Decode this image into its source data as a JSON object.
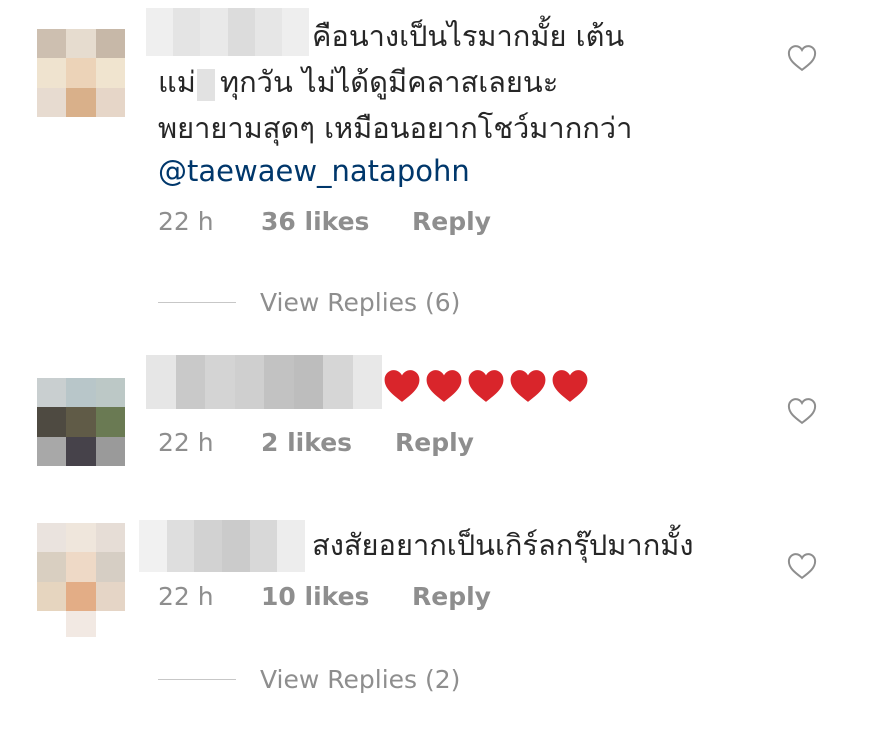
{
  "comments": [
    {
      "text_lines": [
        "คือนางเป็นไรมากมั้ย เต้น",
        "แม่",
        "ทุกวัน ไม่ได้ดูมีคลาสเลยนะ",
        "พยายามสุดๆ เหมือนอยากโชว์มากกว่า"
      ],
      "mention": "@taewaew_natapohn",
      "time": "22 h",
      "likes": "36 likes",
      "reply": "Reply",
      "view_replies": "View Replies (6)"
    },
    {
      "emoji": [
        "heart",
        "heart",
        "heart",
        "heart",
        "heart"
      ],
      "time": "22 h",
      "likes": "2 likes",
      "reply": "Reply"
    },
    {
      "text": "สงสัยอยากเป็นเกิร์ลกรุ๊ปมากมั้ง",
      "time": "22 h",
      "likes": "10 likes",
      "reply": "Reply",
      "view_replies": "View Replies (2)"
    }
  ],
  "icons": {
    "like": "heart-outline-icon",
    "emoji": "red-heart-emoji-icon"
  },
  "colors": {
    "text": "#262626",
    "meta": "#8e8e8e",
    "mention": "#00376b",
    "emoji_heart": "#d9252b"
  }
}
